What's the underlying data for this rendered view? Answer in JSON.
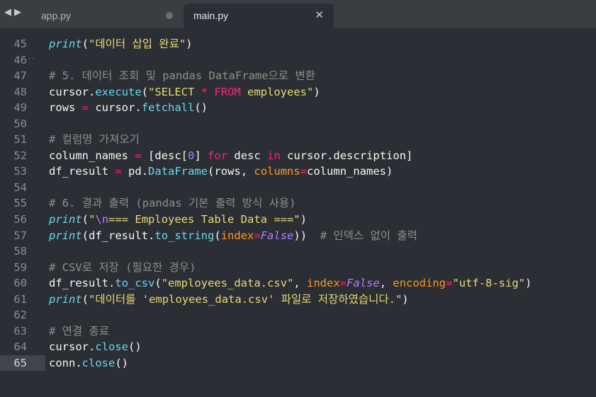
{
  "tabs": [
    {
      "label": "app.py",
      "active": false,
      "modified": true
    },
    {
      "label": "main.py",
      "active": true,
      "close_icon": "close-icon"
    }
  ],
  "nav": {
    "back_icon": "◀",
    "forward_icon": "▶"
  },
  "editor": {
    "current_line": 65,
    "lines": [
      {
        "n": "45",
        "tokens": [
          [
            "fn",
            "print"
          ],
          [
            "p",
            "("
          ],
          [
            "s",
            "\"데이터 삽입 완료\""
          ],
          [
            "p",
            ")"
          ]
        ]
      },
      {
        "n": "46",
        "tokens": []
      },
      {
        "n": "47",
        "tokens": [
          [
            "c",
            "# 5. 데이터 조회 및 pandas DataFrame으로 변환"
          ]
        ]
      },
      {
        "n": "48",
        "tokens": [
          [
            "i",
            "cursor"
          ],
          [
            "p",
            "."
          ],
          [
            "m",
            "execute"
          ],
          [
            "p",
            "("
          ],
          [
            "s",
            "\"SELECT "
          ],
          [
            "k",
            "*"
          ],
          [
            "s",
            " "
          ],
          [
            "k",
            "FROM"
          ],
          [
            "s",
            " employees\""
          ],
          [
            "p",
            ")"
          ]
        ]
      },
      {
        "n": "49",
        "tokens": [
          [
            "i",
            "rows "
          ],
          [
            "o",
            "="
          ],
          [
            "i",
            " cursor"
          ],
          [
            "p",
            "."
          ],
          [
            "m",
            "fetchall"
          ],
          [
            "p",
            "()"
          ]
        ]
      },
      {
        "n": "50",
        "tokens": []
      },
      {
        "n": "51",
        "tokens": [
          [
            "c",
            "# 컬럼명 가져오기"
          ]
        ]
      },
      {
        "n": "52",
        "tokens": [
          [
            "i",
            "column_names "
          ],
          [
            "o",
            "="
          ],
          [
            "p",
            " ["
          ],
          [
            "i",
            "desc"
          ],
          [
            "p",
            "["
          ],
          [
            "num",
            "0"
          ],
          [
            "p",
            "] "
          ],
          [
            "k",
            "for"
          ],
          [
            "i",
            " desc "
          ],
          [
            "k",
            "in"
          ],
          [
            "i",
            " cursor"
          ],
          [
            "p",
            "."
          ],
          [
            "i",
            "description"
          ],
          [
            "p",
            "]"
          ]
        ]
      },
      {
        "n": "53",
        "tokens": [
          [
            "i",
            "df_result "
          ],
          [
            "o",
            "="
          ],
          [
            "i",
            " pd"
          ],
          [
            "p",
            "."
          ],
          [
            "m",
            "DataFrame"
          ],
          [
            "p",
            "("
          ],
          [
            "i",
            "rows"
          ],
          [
            "p",
            ", "
          ],
          [
            "pa",
            "columns"
          ],
          [
            "o",
            "="
          ],
          [
            "i",
            "column_names"
          ],
          [
            "p",
            ")"
          ]
        ]
      },
      {
        "n": "54",
        "tokens": []
      },
      {
        "n": "55",
        "tokens": [
          [
            "c",
            "# 6. 결과 출력 (pandas 기본 출력 방식 사용)"
          ]
        ]
      },
      {
        "n": "56",
        "tokens": [
          [
            "fn",
            "print"
          ],
          [
            "p",
            "("
          ],
          [
            "s",
            "\""
          ],
          [
            "e",
            "\\n"
          ],
          [
            "s",
            "=== Employees Table Data ===\""
          ],
          [
            "p",
            ")"
          ]
        ]
      },
      {
        "n": "57",
        "tokens": [
          [
            "fn",
            "print"
          ],
          [
            "p",
            "("
          ],
          [
            "i",
            "df_result"
          ],
          [
            "p",
            "."
          ],
          [
            "m",
            "to_string"
          ],
          [
            "p",
            "("
          ],
          [
            "pa",
            "index"
          ],
          [
            "o",
            "="
          ],
          [
            "cst",
            "False"
          ],
          [
            "p",
            "))  "
          ],
          [
            "c",
            "# 인덱스 없이 출력"
          ]
        ]
      },
      {
        "n": "58",
        "tokens": []
      },
      {
        "n": "59",
        "tokens": [
          [
            "c",
            "# CSV로 저장 (필요한 경우)"
          ]
        ]
      },
      {
        "n": "60",
        "tokens": [
          [
            "i",
            "df_result"
          ],
          [
            "p",
            "."
          ],
          [
            "m",
            "to_csv"
          ],
          [
            "p",
            "("
          ],
          [
            "s",
            "\"employees_data.csv\""
          ],
          [
            "p",
            ", "
          ],
          [
            "pa",
            "index"
          ],
          [
            "o",
            "="
          ],
          [
            "cst",
            "False"
          ],
          [
            "p",
            ", "
          ],
          [
            "pa",
            "encoding"
          ],
          [
            "o",
            "="
          ],
          [
            "s",
            "\"utf-8-sig\""
          ],
          [
            "p",
            ")"
          ]
        ]
      },
      {
        "n": "61",
        "tokens": [
          [
            "fn",
            "print"
          ],
          [
            "p",
            "("
          ],
          [
            "s",
            "\"데이터를 'employees_data.csv' 파일로 저장하였습니다.\""
          ],
          [
            "p",
            ")"
          ]
        ]
      },
      {
        "n": "62",
        "tokens": []
      },
      {
        "n": "63",
        "tokens": [
          [
            "c",
            "# 연결 종료"
          ]
        ]
      },
      {
        "n": "64",
        "tokens": [
          [
            "i",
            "cursor"
          ],
          [
            "p",
            "."
          ],
          [
            "m",
            "close"
          ],
          [
            "p",
            "()"
          ]
        ]
      },
      {
        "n": "65",
        "tokens": [
          [
            "i",
            "conn"
          ],
          [
            "p",
            "."
          ],
          [
            "m",
            "close"
          ],
          [
            "p",
            "()"
          ]
        ]
      }
    ]
  },
  "colors": {
    "background": "#2b2e34",
    "tabbar": "#3a3d42",
    "string": "#e6db74",
    "comment": "#8f908a",
    "keyword": "#f92672",
    "function": "#66d9ef",
    "param": "#fd971f",
    "constant": "#ae81ff"
  }
}
